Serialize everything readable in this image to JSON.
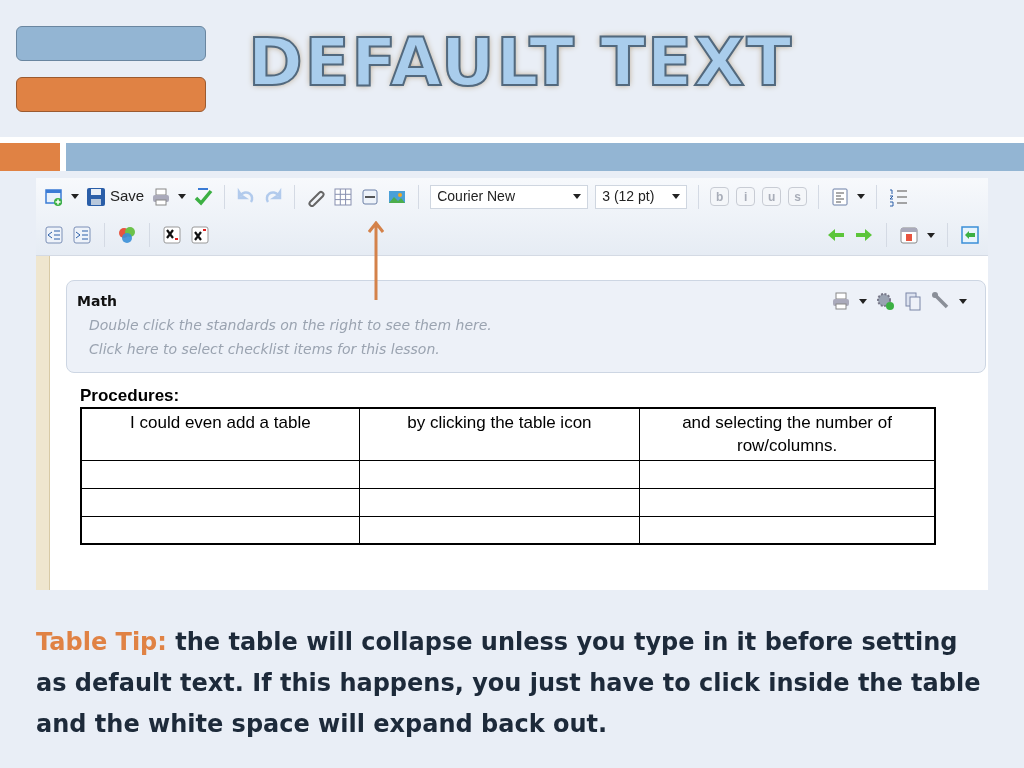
{
  "slide_title": "DEFAULT TEXT",
  "toolbar": {
    "save_label": "Save",
    "history_buttons": [
      {
        "disabled": true
      },
      {
        "disabled": true
      }
    ],
    "font_select": {
      "value": "Courier New"
    },
    "size_select": {
      "value": "3 (12 pt)"
    },
    "format_buttons": [
      {
        "label": "b",
        "disabled": true
      },
      {
        "label": "i",
        "disabled": true
      },
      {
        "label": "u",
        "disabled": true
      },
      {
        "label": "s",
        "disabled": true
      }
    ]
  },
  "panel": {
    "title": "Math",
    "hints": [
      "Double click the standards on the right to see them here.",
      "Click here to select checklist items for this lesson."
    ]
  },
  "editor": {
    "heading": "Procedures:",
    "table_rows": [
      [
        "I could even add a table",
        "by clicking the table icon",
        "and selecting the number of row/columns."
      ]
    ]
  },
  "tip": {
    "label": "Table Tip:",
    "text": "the table will collapse unless you type in it before setting as default text. If this happens, you just have to click inside the table and the white space will expand back out."
  }
}
